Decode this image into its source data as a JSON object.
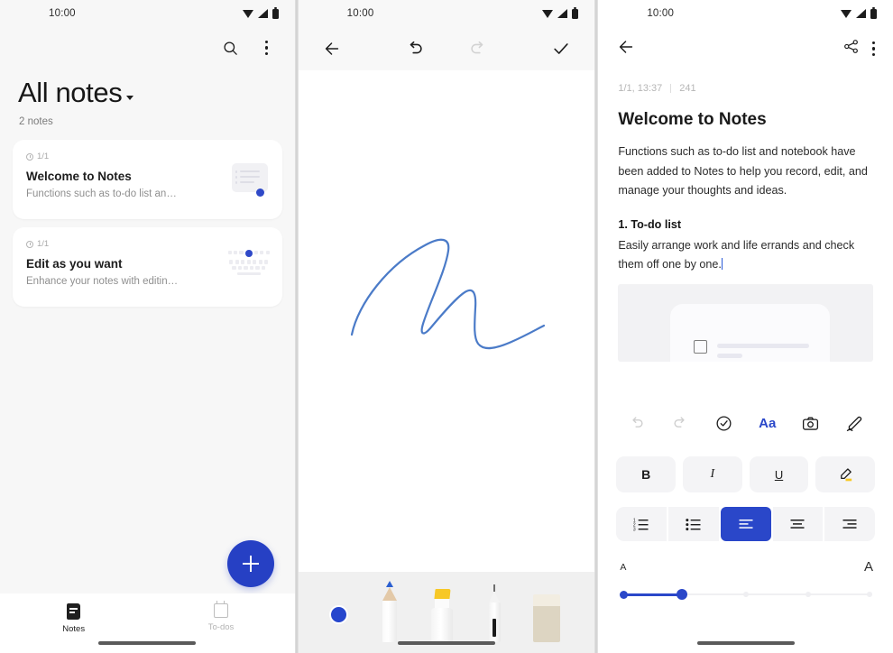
{
  "status": {
    "time": "10:00",
    "icons": [
      "wifi-icon",
      "signal-icon",
      "battery-icon"
    ]
  },
  "colors": {
    "accent": "#2a47c9",
    "fab": "#2640c4",
    "ink": "#4b7bc8",
    "highlight": "#f7c826"
  },
  "panel_list": {
    "search_icon": "search-icon",
    "more_icon": "more-vertical-icon",
    "title": "All notes",
    "title_caret": "caret-down-icon",
    "count": "2 notes",
    "cards": [
      {
        "date": "1/1",
        "title": "Welcome to Notes",
        "preview": "Functions such as to-do list an…",
        "thumb": "document-list-thumbnail"
      },
      {
        "date": "1/1",
        "title": "Edit as you want",
        "preview": "Enhance your notes with editin…",
        "thumb": "keyboard-thumbnail"
      }
    ],
    "fab_label": "+",
    "fab_icon": "plus-icon",
    "nav": [
      {
        "label": "Notes",
        "icon": "notes-icon",
        "active": true
      },
      {
        "label": "To-dos",
        "icon": "todo-calendar-icon",
        "active": false
      }
    ]
  },
  "panel_canvas": {
    "back_icon": "back-arrow-icon",
    "undo_icon": "undo-icon",
    "redo_icon": "redo-icon",
    "confirm_icon": "check-icon",
    "drawing": "blue-handwritten-stroke",
    "tools": [
      {
        "name": "color-wheel",
        "label": "color-picker"
      },
      {
        "name": "pencil",
        "label": "pencil"
      },
      {
        "name": "marker",
        "label": "highlighter-marker"
      },
      {
        "name": "pen",
        "label": "pen"
      },
      {
        "name": "eraser",
        "label": "eraser"
      }
    ]
  },
  "panel_detail": {
    "back_icon": "back-arrow-icon",
    "share_icon": "share-icon",
    "more_icon": "more-vertical-icon",
    "meta_date": "1/1, 13:37",
    "meta_count": "241",
    "title": "Welcome to Notes",
    "paragraph": "Functions such as to-do list and notebook have been added to Notes to help you record, edit, and manage your thoughts and ideas.",
    "section_heading": "1. To-do list",
    "section_body": "Easily arrange work and life errands and check them off one by one.",
    "image_placeholder": "todo-list-screenshot",
    "toolbar_top": [
      {
        "name": "undo",
        "icon": "undo-icon",
        "enabled": false
      },
      {
        "name": "redo",
        "icon": "redo-icon",
        "enabled": false
      },
      {
        "name": "checklist",
        "icon": "check-circle-icon",
        "enabled": true
      },
      {
        "name": "text-format",
        "icon": "text-format-Aa-icon",
        "label": "Aa",
        "enabled": true,
        "selected": true
      },
      {
        "name": "camera",
        "icon": "camera-icon",
        "enabled": true
      },
      {
        "name": "draw",
        "icon": "pen-edit-icon",
        "enabled": true
      }
    ],
    "style_buttons": [
      {
        "name": "bold",
        "label": "B"
      },
      {
        "name": "italic",
        "label": "I"
      },
      {
        "name": "underline",
        "label": "U"
      },
      {
        "name": "highlight",
        "label": "highlighter-icon"
      }
    ],
    "align_buttons": [
      {
        "name": "numbered-list",
        "icon": "ordered-list-icon",
        "selected": false
      },
      {
        "name": "bulleted-list",
        "icon": "bullet-list-icon",
        "selected": false
      },
      {
        "name": "align-left",
        "icon": "align-left-icon",
        "selected": true
      },
      {
        "name": "align-center",
        "icon": "align-center-icon",
        "selected": false
      },
      {
        "name": "align-right",
        "icon": "align-right-icon",
        "selected": false
      }
    ],
    "font_size": {
      "min_label": "A",
      "max_label": "A",
      "steps": 5,
      "value": 2
    }
  }
}
